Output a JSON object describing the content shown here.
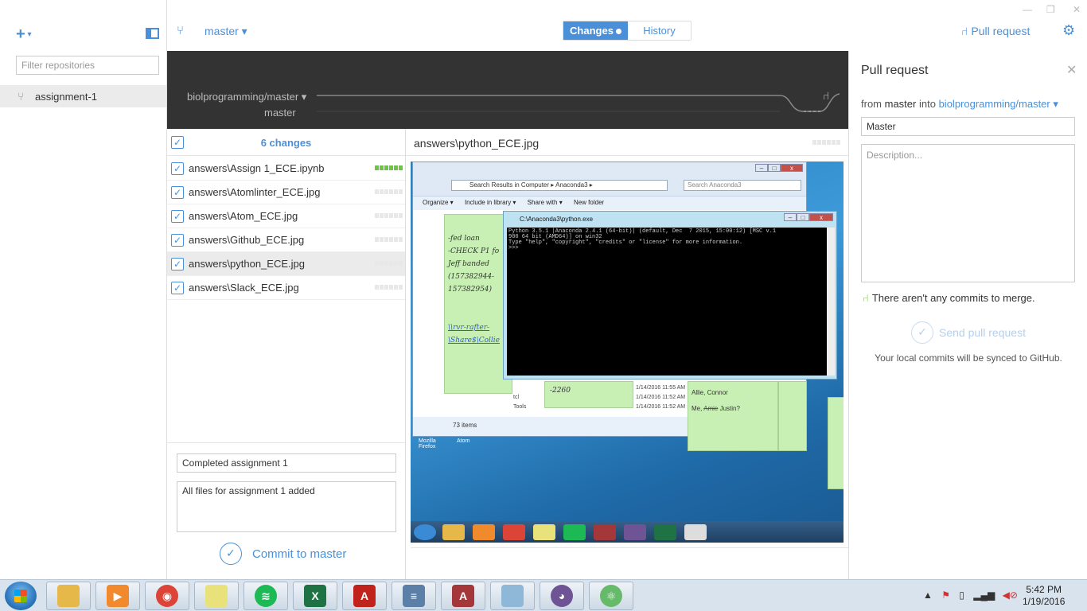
{
  "sidebar": {
    "add_icon": "plus-icon",
    "filter_placeholder": "Filter repositories",
    "repos": [
      {
        "label": "assignment-1",
        "icon": "repo-fork-icon"
      }
    ]
  },
  "topbar": {
    "branch": "master ▾",
    "tab_changes": "Changes",
    "tab_history": "History",
    "pull_request": "Pull request",
    "window_controls": [
      "—",
      "❐",
      "✕"
    ]
  },
  "graph": {
    "upstream": "biolprogramming/master ▾",
    "local": "master"
  },
  "changes": {
    "count_label": "6 changes",
    "files": [
      {
        "name": "answers\\Assign 1_ECE.ipynb",
        "status": "added"
      },
      {
        "name": "answers\\Atomlinter_ECE.jpg",
        "status": "binary"
      },
      {
        "name": "answers\\Atom_ECE.jpg",
        "status": "binary"
      },
      {
        "name": "answers\\Github_ECE.jpg",
        "status": "binary"
      },
      {
        "name": "answers\\python_ECE.jpg",
        "status": "binary",
        "selected": true
      },
      {
        "name": "answers\\Slack_ECE.jpg",
        "status": "binary"
      }
    ],
    "commit_summary": "Completed assignment 1",
    "commit_description": "All files for assignment 1 added",
    "commit_button": "Commit to master"
  },
  "diff": {
    "title": "answers\\python_ECE.jpg",
    "image": {
      "explorer_address": "Search Results in Computer  ▸  Anaconda3  ▸",
      "explorer_search": "Search Anaconda3",
      "explorer_toolbar": [
        "Organize ▾",
        "Include in library ▾",
        "Share with ▾",
        "New folder"
      ],
      "explorer_status": "73 items",
      "note1_lines": [
        "-fed loan",
        "-CHECK P1 fo",
        "Jeff banded",
        "(157382944-",
        "157382954)"
      ],
      "note1_links": [
        "\\\\rvr-rafter-",
        "\\Share$\\Collie"
      ],
      "note2": "-2260",
      "note3_lines": [
        "Allie, Connor",
        "Me, Amie Justin?"
      ],
      "console_title": "C:\\Anaconda3\\python.exe",
      "console_text": "Python 3.5.1 |Anaconda 2.4.1 (64-bit)| (default, Dec  7 2015, 15:00:12) [MSC v.1\n900 64 bit (AMD64)] on win32\nType \"help\", \"copyright\", \"credits\" or \"license\" for more information.\n>>>",
      "desktop_icons": [
        "Mozilla Firefox",
        "Atom"
      ],
      "file_times": [
        "1/14/2016 11:55 AM",
        "1/14/2016 11:52 AM",
        "1/14/2016 11:52 AM"
      ],
      "file_names": [
        "tcl",
        "Tools"
      ]
    }
  },
  "pull_request_panel": {
    "title": "Pull request",
    "from_prefix": "from",
    "from_branch": "master",
    "into_label": "into",
    "target": "biolprogramming/master ▾",
    "title_value": "Master",
    "description_placeholder": "Description...",
    "no_commits": "There aren't any commits to merge.",
    "send_button": "Send pull request",
    "sync_note": "Your local commits will be synced to GitHub."
  },
  "taskbar": {
    "apps": [
      {
        "name": "file-explorer-icon",
        "color": "#e6b84a"
      },
      {
        "name": "media-player-icon",
        "color": "#f08a2c"
      },
      {
        "name": "chrome-icon",
        "color": "#db4437"
      },
      {
        "name": "sticky-notes-icon",
        "color": "#e9e27a"
      },
      {
        "name": "spotify-icon",
        "color": "#1db954"
      },
      {
        "name": "excel-icon",
        "color": "#1f7244"
      },
      {
        "name": "acrobat-icon",
        "color": "#c0231b"
      },
      {
        "name": "reader-icon",
        "color": "#5b7fa6"
      },
      {
        "name": "access-icon",
        "color": "#a4373a"
      },
      {
        "name": "notepad-icon",
        "color": "#8fb8d8"
      },
      {
        "name": "github-desktop-icon",
        "color": "#6e5494"
      },
      {
        "name": "atom-icon",
        "color": "#66bb6a"
      }
    ],
    "time": "5:42 PM",
    "date": "1/19/2016"
  },
  "colors": {
    "accent": "#4a90d9",
    "graph_bg": "#333333",
    "added": "#6cc644"
  }
}
